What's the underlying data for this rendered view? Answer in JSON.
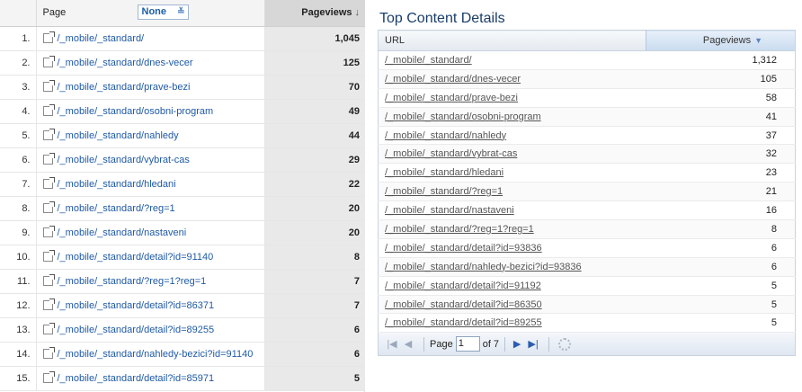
{
  "left": {
    "header": {
      "page_label": "Page",
      "none_label": "None",
      "pageviews_label": "Pageviews",
      "sort_icon": "arrow-down-icon"
    },
    "rows": [
      {
        "num": "1.",
        "page": "/_mobile/_standard/",
        "pv": "1,045"
      },
      {
        "num": "2.",
        "page": "/_mobile/_standard/dnes-vecer",
        "pv": "125"
      },
      {
        "num": "3.",
        "page": "/_mobile/_standard/prave-bezi",
        "pv": "70"
      },
      {
        "num": "4.",
        "page": "/_mobile/_standard/osobni-program",
        "pv": "49"
      },
      {
        "num": "5.",
        "page": "/_mobile/_standard/nahledy",
        "pv": "44"
      },
      {
        "num": "6.",
        "page": "/_mobile/_standard/vybrat-cas",
        "pv": "29"
      },
      {
        "num": "7.",
        "page": "/_mobile/_standard/hledani",
        "pv": "22"
      },
      {
        "num": "8.",
        "page": "/_mobile/_standard/?reg=1",
        "pv": "20"
      },
      {
        "num": "9.",
        "page": "/_mobile/_standard/nastaveni",
        "pv": "20"
      },
      {
        "num": "10.",
        "page": "/_mobile/_standard/detail?id=91140",
        "pv": "8"
      },
      {
        "num": "11.",
        "page": "/_mobile/_standard/?reg=1?reg=1",
        "pv": "7"
      },
      {
        "num": "12.",
        "page": "/_mobile/_standard/detail?id=86371",
        "pv": "7"
      },
      {
        "num": "13.",
        "page": "/_mobile/_standard/detail?id=89255",
        "pv": "6"
      },
      {
        "num": "14.",
        "page": "/_mobile/_standard/nahledy-bezici?id=91140",
        "pv": "6"
      },
      {
        "num": "15.",
        "page": "/_mobile/_standard/detail?id=85971",
        "pv": "5"
      }
    ]
  },
  "right": {
    "title": "Top Content Details",
    "header": {
      "url_label": "URL",
      "pageviews_label": "Pageviews"
    },
    "rows": [
      {
        "url": "/_mobile/_standard/",
        "pv": "1,312"
      },
      {
        "url": "/_mobile/_standard/dnes-vecer",
        "pv": "105"
      },
      {
        "url": "/_mobile/_standard/prave-bezi",
        "pv": "58"
      },
      {
        "url": "/_mobile/_standard/osobni-program",
        "pv": "41"
      },
      {
        "url": "/_mobile/_standard/nahledy",
        "pv": "37"
      },
      {
        "url": "/_mobile/_standard/vybrat-cas",
        "pv": "32"
      },
      {
        "url": "/_mobile/_standard/hledani",
        "pv": "23"
      },
      {
        "url": "/_mobile/_standard/?reg=1",
        "pv": "21"
      },
      {
        "url": "/_mobile/_standard/nastaveni",
        "pv": "16"
      },
      {
        "url": "/_mobile/_standard/?reg=1?reg=1",
        "pv": "8"
      },
      {
        "url": "/_mobile/_standard/detail?id=93836",
        "pv": "6"
      },
      {
        "url": "/_mobile/_standard/nahledy-bezici?id=93836",
        "pv": "6"
      },
      {
        "url": "/_mobile/_standard/detail?id=91192",
        "pv": "5"
      },
      {
        "url": "/_mobile/_standard/detail?id=86350",
        "pv": "5"
      },
      {
        "url": "/_mobile/_standard/detail?id=89255",
        "pv": "5"
      }
    ],
    "pager": {
      "page_label": "Page",
      "page_value": "1",
      "of_label": "of 7"
    }
  },
  "colors": {
    "link": "#1f5aa6",
    "title": "#1a3d6b",
    "sorted_column_bg": "#e9e9e9"
  }
}
